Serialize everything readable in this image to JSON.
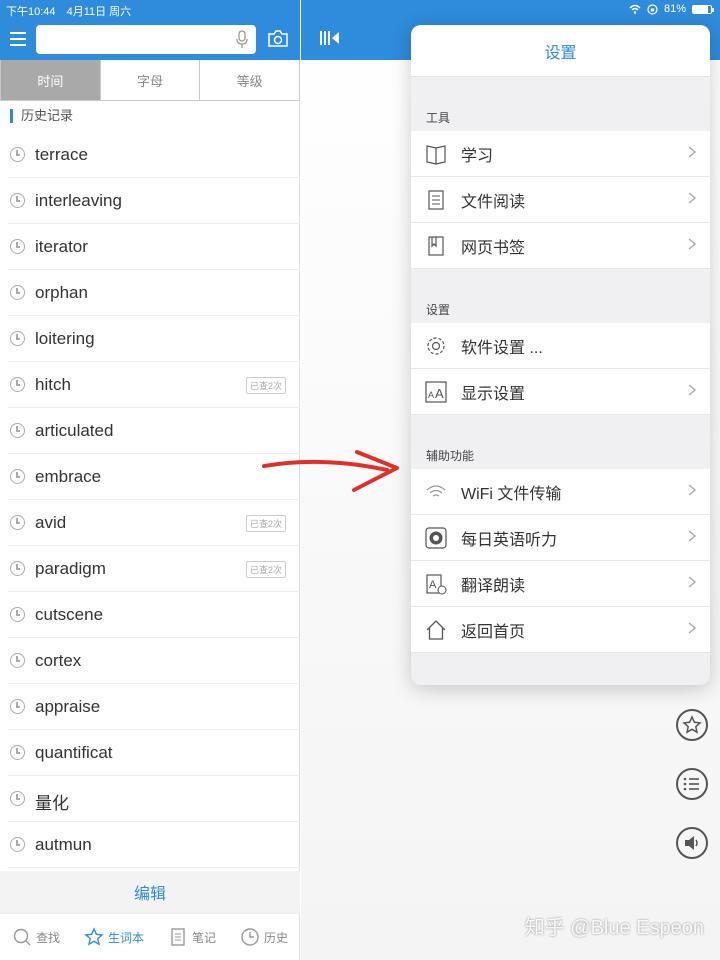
{
  "statusbar": {
    "time": "下午10:44",
    "date": "4月11日 周六",
    "battery": "81%",
    "battery_level": 0.81
  },
  "left": {
    "segments": [
      "时间",
      "字母",
      "等级"
    ],
    "active_segment": 0,
    "history_title": "历史记录",
    "history": [
      {
        "word": "terrace",
        "badge": ""
      },
      {
        "word": "interleaving",
        "badge": ""
      },
      {
        "word": "iterator",
        "badge": ""
      },
      {
        "word": "orphan",
        "badge": ""
      },
      {
        "word": "loitering",
        "badge": ""
      },
      {
        "word": "hitch",
        "badge": "已查2次"
      },
      {
        "word": "articulated",
        "badge": ""
      },
      {
        "word": "embrace",
        "badge": ""
      },
      {
        "word": "avid",
        "badge": "已查2次"
      },
      {
        "word": "paradigm",
        "badge": "已查2次"
      },
      {
        "word": "cutscene",
        "badge": ""
      },
      {
        "word": "cortex",
        "badge": ""
      },
      {
        "word": "appraise",
        "badge": ""
      },
      {
        "word": "quantificat",
        "badge": ""
      },
      {
        "word": "量化",
        "badge": ""
      },
      {
        "word": "autmun",
        "badge": ""
      }
    ],
    "edit_label": "编辑",
    "tabs": [
      {
        "label": "查找",
        "icon": "search-icon"
      },
      {
        "label": "生词本",
        "icon": "star-icon"
      },
      {
        "label": "笔记",
        "icon": "note-icon"
      },
      {
        "label": "历史",
        "icon": "clock-icon"
      }
    ],
    "active_tab": 1
  },
  "popup": {
    "title": "设置",
    "groups": [
      {
        "label": "工具",
        "items": [
          {
            "label": "学习",
            "icon": "book-icon",
            "chevron": true
          },
          {
            "label": "文件阅读",
            "icon": "document-icon",
            "chevron": true
          },
          {
            "label": "网页书签",
            "icon": "bookmark-icon",
            "chevron": true
          }
        ]
      },
      {
        "label": "设置",
        "items": [
          {
            "label": "软件设置 ...",
            "icon": "gear-icon",
            "chevron": false
          },
          {
            "label": "显示设置",
            "icon": "font-size-icon",
            "chevron": true
          }
        ]
      },
      {
        "label": "辅助功能",
        "items": [
          {
            "label": "WiFi 文件传输",
            "icon": "wifi-icon",
            "chevron": true
          },
          {
            "label": "每日英语听力",
            "icon": "listening-icon",
            "chevron": true
          },
          {
            "label": "翻译朗读",
            "icon": "translate-icon",
            "chevron": true
          },
          {
            "label": "返回首页",
            "icon": "home-icon",
            "chevron": true
          }
        ]
      }
    ]
  },
  "watermark": "知乎 @Blue Espeon",
  "colors": {
    "accent": "#2f8bdc",
    "arrow": "#e0302a"
  }
}
